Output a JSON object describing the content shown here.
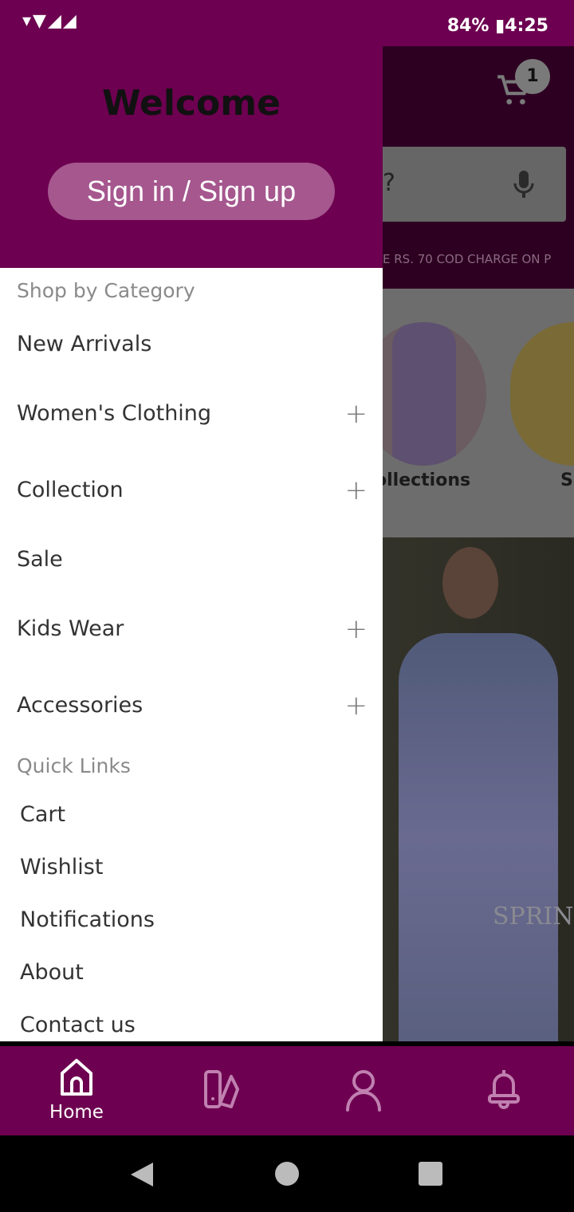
{
  "status_bar": {
    "battery": "84%",
    "time": "4:25"
  },
  "background": {
    "cart_badge": "1",
    "search_placeholder_visible": "?",
    "promo_text": "E RS. 70 COD CHARGE ON P",
    "categories": [
      "ollections",
      "S"
    ],
    "banner_text": "SPRIN"
  },
  "drawer": {
    "welcome": "Welcome",
    "signin_label": "Sign in / Sign up",
    "shop_section": "Shop by Category",
    "categories": [
      {
        "label": "New Arrivals",
        "expandable": false
      },
      {
        "label": "Women's Clothing",
        "expandable": true
      },
      {
        "label": "Collection",
        "expandable": true
      },
      {
        "label": "Sale",
        "expandable": false
      },
      {
        "label": "Kids Wear",
        "expandable": true
      },
      {
        "label": "Accessories",
        "expandable": true
      }
    ],
    "plus": "+",
    "quick_section": "Quick Links",
    "quick_links": [
      "Cart",
      "Wishlist",
      "Notifications",
      "About",
      "Contact us"
    ]
  },
  "bottom_nav": {
    "home_label": "Home",
    "active": "home",
    "active_color": "#ffffff",
    "inactive_color": "#c080b0"
  },
  "colors": {
    "brand": "#6d0050",
    "signin_button": "#a5578e"
  }
}
